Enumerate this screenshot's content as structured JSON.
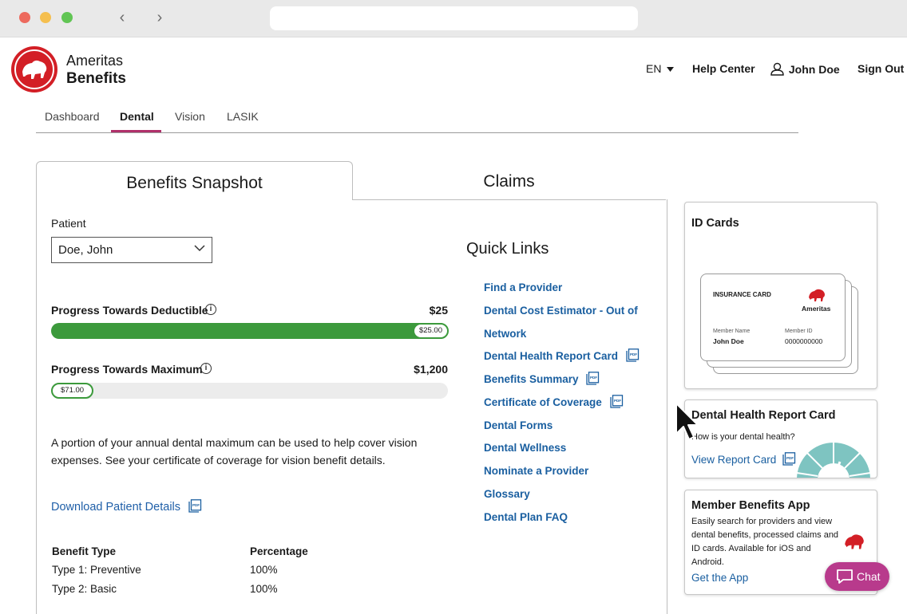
{
  "brand": {
    "line1": "Ameritas",
    "line2": "Benefits",
    "accent": "#d31f26"
  },
  "header": {
    "language": "EN",
    "help": "Help Center",
    "user": "John Doe",
    "signout": "Sign Out"
  },
  "nav_tabs": [
    "Dashboard",
    "Dental",
    "Vision",
    "LASIK"
  ],
  "main_tabs": {
    "snapshot": "Benefits Snapshot",
    "claims": "Claims"
  },
  "patient": {
    "label": "Patient",
    "value": "Doe, John"
  },
  "deductible": {
    "label": "Progress Towards Deductible",
    "amount": "$25",
    "pill": "$25.00",
    "progress": 1.0
  },
  "maximum": {
    "label": "Progress Towards Maximum",
    "amount": "$1,200",
    "pill": "$71.00",
    "progress": 0.06
  },
  "paragraph": "A portion of your annual dental maximum can be used to help cover vision expenses. See your certificate of coverage for vision benefit details.",
  "download": "Download Patient Details",
  "benefit_table": {
    "headers": [
      "Benefit Type",
      "Percentage"
    ],
    "rows": [
      [
        "Type 1: Preventive",
        "100%"
      ],
      [
        "Type 2: Basic",
        "100%"
      ]
    ]
  },
  "quick_links": {
    "title": "Quick Links",
    "items": [
      "Find a Provider",
      "Dental Cost Estimator - Out of",
      "Network",
      "Dental Health Report Card",
      "Benefits Summary",
      "Certificate of Coverage",
      "Dental Forms",
      "Dental Wellness",
      "Nominate a Provider",
      "Glossary",
      "Dental Plan FAQ"
    ]
  },
  "id_cards": {
    "title": "ID Cards",
    "card_heading": "INSURANCE CARD",
    "card_brand": "Ameritas",
    "member_name_label": "Member Name",
    "member_name": "John Doe",
    "member_id_label": "Member ID",
    "member_id": "0000000000"
  },
  "report_card": {
    "title": "Dental Health Report Card",
    "question": "How is your dental health?",
    "link": "View Report Card"
  },
  "app": {
    "title": "Member Benefits App",
    "lines": [
      "Easily search for providers and view",
      "dental benefits, processed claims and",
      "ID cards. Available for iOS and",
      "Android."
    ],
    "link": "Get the App"
  },
  "chat": "Chat"
}
